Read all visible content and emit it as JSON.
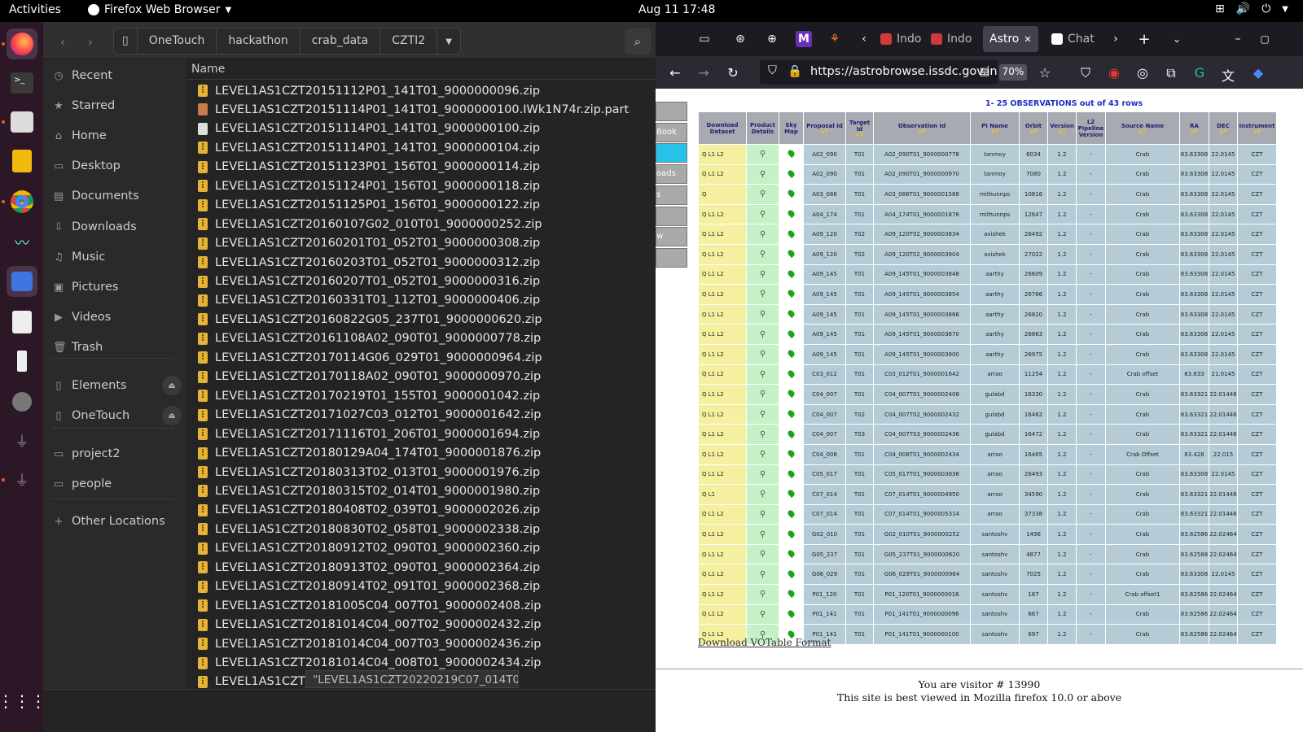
{
  "topbar": {
    "activities": "Activities",
    "app_name": "Firefox Web Browser",
    "datetime": "Aug 11  17:48"
  },
  "files": {
    "breadcrumbs": [
      "OneTouch",
      "hackathon",
      "crab_data",
      "CZTI2"
    ],
    "sidebar": [
      {
        "icon": "clock-icon",
        "label": "Recent"
      },
      {
        "icon": "star-icon",
        "label": "Starred"
      },
      {
        "icon": "home-icon",
        "label": "Home"
      },
      {
        "icon": "desktop-icon",
        "label": "Desktop"
      },
      {
        "icon": "documents-icon",
        "label": "Documents"
      },
      {
        "icon": "downloads-icon",
        "label": "Downloads"
      },
      {
        "icon": "music-icon",
        "label": "Music"
      },
      {
        "icon": "pictures-icon",
        "label": "Pictures"
      },
      {
        "icon": "videos-icon",
        "label": "Videos"
      },
      {
        "icon": "trash-icon",
        "label": "Trash"
      },
      {
        "icon": "drive-icon",
        "label": "Elements"
      },
      {
        "icon": "drive-icon",
        "label": "OneTouch"
      },
      {
        "icon": "folder-icon",
        "label": "project2"
      },
      {
        "icon": "folder-icon",
        "label": "people"
      },
      {
        "icon": "plus-icon",
        "label": "Other Locations"
      }
    ],
    "column_name": "Name",
    "items": [
      "LEVEL1AS1CZT20151112P01_141T01_9000000096.zip",
      "LEVEL1AS1CZT20151114P01_141T01_9000000100.IWk1N74r.zip.part",
      "LEVEL1AS1CZT20151114P01_141T01_9000000100.zip",
      "LEVEL1AS1CZT20151114P01_141T01_9000000104.zip",
      "LEVEL1AS1CZT20151123P01_156T01_9000000114.zip",
      "LEVEL1AS1CZT20151124P01_156T01_9000000118.zip",
      "LEVEL1AS1CZT20151125P01_156T01_9000000122.zip",
      "LEVEL1AS1CZT20160107G02_010T01_9000000252.zip",
      "LEVEL1AS1CZT20160201T01_052T01_9000000308.zip",
      "LEVEL1AS1CZT20160203T01_052T01_9000000312.zip",
      "LEVEL1AS1CZT20160207T01_052T01_9000000316.zip",
      "LEVEL1AS1CZT20160331T01_112T01_9000000406.zip",
      "LEVEL1AS1CZT20160822G05_237T01_9000000620.zip",
      "LEVEL1AS1CZT20161108A02_090T01_9000000778.zip",
      "LEVEL1AS1CZT20170114G06_029T01_9000000964.zip",
      "LEVEL1AS1CZT20170118A02_090T01_9000000970.zip",
      "LEVEL1AS1CZT20170219T01_155T01_9000001042.zip",
      "LEVEL1AS1CZT20171027C03_012T01_9000001642.zip",
      "LEVEL1AS1CZT20171116T01_206T01_9000001694.zip",
      "LEVEL1AS1CZT20180129A04_174T01_9000001876.zip",
      "LEVEL1AS1CZT20180313T02_013T01_9000001976.zip",
      "LEVEL1AS1CZT20180315T02_014T01_9000001980.zip",
      "LEVEL1AS1CZT20180408T02_039T01_9000002026.zip",
      "LEVEL1AS1CZT20180830T02_058T01_9000002338.zip",
      "LEVEL1AS1CZT20180912T02_090T01_9000002360.zip",
      "LEVEL1AS1CZT20180913T02_090T01_9000002364.zip",
      "LEVEL1AS1CZT20180914T02_091T01_9000002368.zip",
      "LEVEL1AS1CZT20181005C04_007T01_9000002408.zip",
      "LEVEL1AS1CZT20181014C04_007T02_9000002432.zip",
      "LEVEL1AS1CZT20181014C04_007T03_9000002436.zip",
      "LEVEL1AS1CZT20181014C04_008T01_9000002434.zip",
      "LEVEL1AS1CZT20181029T03_024T01_90000"
    ],
    "tooltip": "\"LEVEL1AS1CZT20220219C07_014T01"
  },
  "browser": {
    "tabs": [
      {
        "label": "Indo",
        "color": "#d13a3a",
        "selected": false
      },
      {
        "label": "Indo",
        "color": "#d13a3a",
        "selected": false
      },
      {
        "label": "Astro",
        "color": "#42414d",
        "selected": true
      },
      {
        "label": "Chat",
        "color": "#ffffff",
        "selected": false
      }
    ],
    "url": "https://astrobrowse.issdc.gov.in",
    "zoom": "70%",
    "left_menu": [
      "",
      "Book",
      "",
      "oads",
      "s",
      "",
      "w",
      ""
    ],
    "results_title": "1- 25 OBSERVATIONS out of 43 rows",
    "headers": [
      "Download Dataset",
      "Product Details",
      "Sky Map",
      "Proposal Id",
      "Target Id",
      "Observation Id",
      "PI Name",
      "Orbit",
      "Version",
      "L2 Pipeline Version",
      "Source Name",
      "RA",
      "DEC",
      "Instrument"
    ],
    "rows": [
      [
        "Q L1 L2",
        "A02_090",
        "T01",
        "A02_090T01_9000000778",
        "tanmoy",
        "6034",
        "1.2",
        "-",
        "Crab",
        "83.63308",
        "22.0145",
        "CZT"
      ],
      [
        "Q L1 L2",
        "A02_090",
        "T01",
        "A02_090T01_9000000970",
        "tanmoy",
        "7080",
        "1.2",
        "-",
        "Crab",
        "83.63308",
        "22.0145",
        "CZT"
      ],
      [
        "Q",
        "A03_086",
        "T01",
        "A03_086T01_9000001568",
        "mithunnps",
        "10816",
        "1.2",
        "-",
        "Crab",
        "83.63308",
        "22.0145",
        "CZT"
      ],
      [
        "Q L1 L2",
        "A04_174",
        "T01",
        "A04_174T01_9000001876",
        "mithunnps",
        "12647",
        "1.2",
        "-",
        "Crab",
        "83.63308",
        "22.0145",
        "CZT"
      ],
      [
        "Q L1 L2",
        "A09_120",
        "T02",
        "A09_120T02_9000003834",
        "avishek",
        "26492",
        "1.2",
        "-",
        "Crab",
        "83.63308",
        "22.0145",
        "CZT"
      ],
      [
        "Q L1 L2",
        "A09_120",
        "T02",
        "A09_120T02_9000003904",
        "avishek",
        "27022",
        "1.2",
        "-",
        "Crab",
        "83.63308",
        "22.0145",
        "CZT"
      ],
      [
        "Q L1 L2",
        "A09_145",
        "T01",
        "A09_145T01_9000003848",
        "aarthy",
        "26609",
        "1.2",
        "-",
        "Crab",
        "83.63308",
        "22.0145",
        "CZT"
      ],
      [
        "Q L1 L2",
        "A09_145",
        "T01",
        "A09_145T01_9000003854",
        "aarthy",
        "26766",
        "1.2",
        "-",
        "Crab",
        "83.63308",
        "22.0145",
        "CZT"
      ],
      [
        "Q L1 L2",
        "A09_145",
        "T01",
        "A09_145T01_9000003866",
        "aarthy",
        "26820",
        "1.2",
        "-",
        "Crab",
        "83.63308",
        "22.0145",
        "CZT"
      ],
      [
        "Q L1 L2",
        "A09_145",
        "T01",
        "A09_145T01_9000003870",
        "aarthy",
        "26863",
        "1.2",
        "-",
        "Crab",
        "83.63308",
        "22.0145",
        "CZT"
      ],
      [
        "Q L1 L2",
        "A09_145",
        "T01",
        "A09_145T01_9000003900",
        "aarthy",
        "26975",
        "1.2",
        "-",
        "Crab",
        "83.63308",
        "22.0145",
        "CZT"
      ],
      [
        "Q L1 L2",
        "C03_012",
        "T01",
        "C03_012T01_9000001642",
        "arrao",
        "11254",
        "1.2",
        "-",
        "Crab offset",
        "83.633",
        "21.0145",
        "CZT"
      ],
      [
        "Q L1 L2",
        "C04_007",
        "T01",
        "C04_007T01_9000002408",
        "gulabd",
        "16330",
        "1.2",
        "-",
        "Crab",
        "83.63321",
        "22.01446",
        "CZT"
      ],
      [
        "Q L1 L2",
        "C04_007",
        "T02",
        "C04_007T02_9000002432",
        "gulabd",
        "16462",
        "1.2",
        "-",
        "Crab",
        "83.63321",
        "22.01446",
        "CZT"
      ],
      [
        "Q L1 L2",
        "C04_007",
        "T03",
        "C04_007T03_9000002436",
        "gulabd",
        "16472",
        "1.2",
        "-",
        "Crab",
        "83.63321",
        "22.01446",
        "CZT"
      ],
      [
        "Q L1 L2",
        "C04_008",
        "T01",
        "C04_008T01_9000002434",
        "arrao",
        "16465",
        "1.2",
        "-",
        "Crab Offset",
        "83.428",
        "22.015",
        "CZT"
      ],
      [
        "Q L1 L2",
        "C05_017",
        "T01",
        "C05_017T01_9000003836",
        "arrao",
        "26493",
        "1.2",
        "-",
        "Crab",
        "83.63308",
        "22.0145",
        "CZT"
      ],
      [
        "Q L1",
        "C07_014",
        "T01",
        "C07_014T01_9000004950",
        "arrao",
        "34590",
        "1.2",
        "-",
        "Crab",
        "83.63321",
        "22.01446",
        "CZT"
      ],
      [
        "Q L1 L2",
        "C07_014",
        "T01",
        "C07_014T01_9000005314",
        "arrao",
        "37338",
        "1.2",
        "-",
        "Crab",
        "83.63321",
        "22.01446",
        "CZT"
      ],
      [
        "Q L1 L2",
        "G02_010",
        "T01",
        "G02_010T01_9000000252",
        "santoshv",
        "1496",
        "1.2",
        "-",
        "Crab",
        "83.62586",
        "22.02464",
        "CZT"
      ],
      [
        "Q L1 L2",
        "G05_237",
        "T01",
        "G05_237T01_9000000620",
        "santoshv",
        "4877",
        "1.2",
        "-",
        "Crab",
        "83.62588",
        "22.02464",
        "CZT"
      ],
      [
        "Q L1 L2",
        "G06_029",
        "T01",
        "G06_029T01_9000000964",
        "santoshv",
        "7025",
        "1.2",
        "-",
        "Crab",
        "83.63308",
        "22.0145",
        "CZT"
      ],
      [
        "Q L1 L2",
        "P01_120",
        "T01",
        "P01_120T01_9000000016",
        "santoshv",
        "187",
        "1.2",
        "-",
        "Crab offset1",
        "83.62586",
        "22.02464",
        "CZT"
      ],
      [
        "Q L1 L2",
        "P01_141",
        "T01",
        "P01_141T01_9000000096",
        "santoshv",
        "667",
        "1.2",
        "-",
        "Crab",
        "83.62586",
        "22.02464",
        "CZT"
      ],
      [
        "Q L1 L2",
        "P01_141",
        "T01",
        "P01_141T01_9000000100",
        "santoshv",
        "697",
        "1.2",
        "-",
        "Crab",
        "83.62586",
        "22.02464",
        "CZT"
      ]
    ],
    "votable_link": "Download VOTable Format",
    "visitor_text": "You are visitor # 13990",
    "bestview_text": "This site is best viewed in Mozilla firefox 10.0 or above"
  }
}
